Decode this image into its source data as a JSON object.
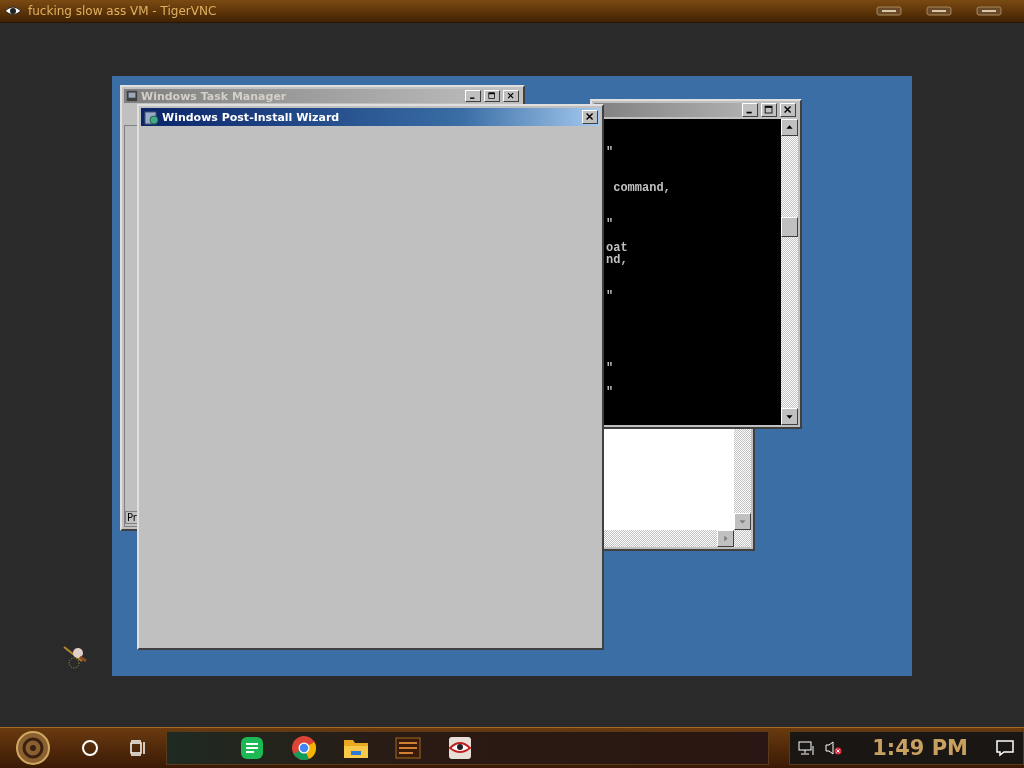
{
  "vnc_window": {
    "title": "fucking slow ass VM - TigerVNC"
  },
  "task_manager": {
    "title": "Windows Task Manager",
    "tab_fragment": "Pr"
  },
  "console": {
    "text": "\"\n\n\n command,\n\n\n\"\n\noat\nnd,\n\n\n\"\n\n\n\n\n\n\"\n\n\""
  },
  "wizard": {
    "title": "Windows Post-Install Wizard"
  },
  "taskbar": {
    "pinned": [
      {
        "kind": "messages"
      },
      {
        "kind": "browser"
      },
      {
        "kind": "folder"
      },
      {
        "kind": "app"
      },
      {
        "kind": "viewer"
      }
    ],
    "clock": "1:49 PM"
  }
}
